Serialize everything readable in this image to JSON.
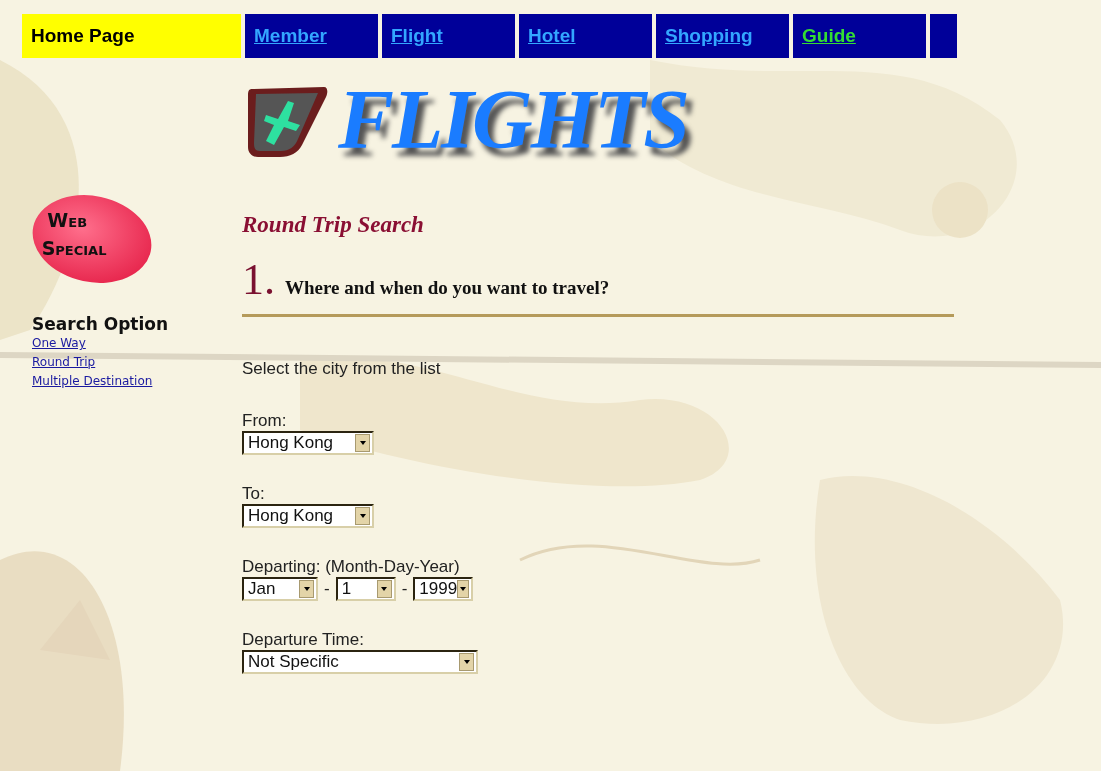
{
  "nav": {
    "tabs": [
      {
        "label": "Home Page",
        "selected": true,
        "kind": "plain"
      },
      {
        "label": "Member",
        "selected": false,
        "kind": "plain"
      },
      {
        "label": "Flight",
        "selected": false,
        "kind": "plain"
      },
      {
        "label": "Hotel",
        "selected": false,
        "kind": "plain"
      },
      {
        "label": "Shopping",
        "selected": false,
        "kind": "plain"
      },
      {
        "label": "Guide",
        "selected": false,
        "kind": "highlight"
      }
    ]
  },
  "logo": {
    "text": "FLIGHTS"
  },
  "web_special": {
    "line_1": "Web",
    "line_2": "Special"
  },
  "sidebar": {
    "heading": "Search Option",
    "links": [
      "One Way",
      "Round Trip",
      "Multiple Destination"
    ]
  },
  "main": {
    "title": "Round Trip Search",
    "step_number": "1.",
    "step_title": "Where and when do you want to travel?",
    "intro": "Select the city from the list",
    "fields": [
      {
        "kind": "city",
        "label": "From:",
        "selects": [
          "Hong Kong"
        ]
      },
      {
        "kind": "city",
        "label": "To:",
        "selects": [
          "Hong Kong"
        ]
      },
      {
        "kind": "date",
        "label": "Departing: (Month-Day-Year)",
        "separator": "-",
        "selects": [
          "Jan",
          "1",
          "1999"
        ]
      },
      {
        "kind": "time",
        "label": "Departure Time:",
        "selects": [
          "Not Specific"
        ]
      }
    ]
  }
}
